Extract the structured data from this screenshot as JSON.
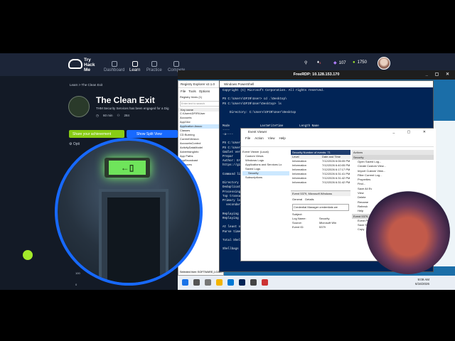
{
  "nav": {
    "logo_line1": "Try",
    "logo_line2": "Hack",
    "logo_line3": "Me",
    "items": [
      {
        "label": "Dashboard",
        "active": false
      },
      {
        "label": "Learn",
        "active": true
      },
      {
        "label": "Practice",
        "active": false
      },
      {
        "label": "Compete",
        "active": false
      }
    ],
    "points": "107",
    "streak": "1750",
    "notification_count": "3"
  },
  "room": {
    "breadcrumb": "Learn > The Clean Exit",
    "title": "The Clean Exit",
    "description": "THM Security Services has been engaged for a Dig",
    "duration": "60 min",
    "users": "284",
    "share_label": "Share your achievement",
    "split_label": "Show Split View",
    "options_label": "Opti"
  },
  "rdp": {
    "title": "FreeRDP: 10.128.153.170"
  },
  "regedit": {
    "title": "Registry Explorer v2.1.0",
    "menu": [
      "File",
      "Tools",
      "Options",
      "Bookm"
    ],
    "tab": "Registry hives (1)",
    "tab2": "Available bo",
    "search_placeholder": "Enter text to search",
    "col": "Key name",
    "tree": [
      "C:\\Users\\DFIR\\User",
      "Accounts",
      "AppXAe",
      "Application Assoc",
      "Classes",
      "CD Burning",
      "CurrentVersion",
      "AccountsControl",
      "ActivityDataModel",
      "AdvertisingInfo",
      "App Paths",
      "AppBroadcast",
      "Approves",
      "Applets"
    ],
    "status": "Selected hive: SOFTWARE_LOAD, Last write:",
    "status2": "Collapse all hives: SOFTWARE_ARC  Nodes"
  },
  "powershell": {
    "title": "Windows PowerShell",
    "lines": [
      "Copyright (C) Microsoft Corporation. All rights reserved.",
      "",
      "PS C:\\Users\\DFIR\\User> cd .\\Desktop\\",
      "PS C:\\Users\\DFIR\\User\\Desktop> ls",
      "",
      "    Directory: C:\\Users\\DFIR\\User\\Desktop",
      "",
      "",
      "Mode                 LastWriteTime         Length Name",
      "----                 -------------         ------ ----",
      "-a----    7/4/2024   9:44 AM         2810 ...",
      "",
      "PS C:\\Users\\",
      "PS C:\\Users\\",
      "Cmdlet ver",
      "Prepar",
      "Author: Eri",
      "https://git",
      "",
      "Command lin",
      "",
      "Directory (",
      "Deduplicati",
      "Processing",
      "Top transac",
      "Primary log",
      "  secondary",
      "",
      "Replaying L",
      "Replaying L",
      "",
      "At least on",
      "Parse time",
      "",
      "Total Shell",
      "",
      "Shellbags d"
    ]
  },
  "eventviewer": {
    "title": "Event Viewer",
    "menu": [
      "File",
      "Action",
      "View",
      "Help"
    ],
    "tree": [
      "Event Viewer (Local)",
      "Custom Views",
      "Windows Logs",
      "Applications and Services Lo",
      "Saved Logs",
      "Security",
      "Subscriptions"
    ],
    "list_header": "Security   Number of events: 71",
    "cols": [
      "Level",
      "Date and Time"
    ],
    "rows": [
      {
        "level": "Information",
        "date": "7/12/2026 6:06:05 PM"
      },
      {
        "level": "Information",
        "date": "7/12/2026 6:40:05 PM"
      },
      {
        "level": "Information",
        "date": "7/12/2026 6:17:17 PM"
      },
      {
        "level": "Information",
        "date": "7/12/2026 6:31:41 PM"
      },
      {
        "level": "Information",
        "date": "7/12/2026 6:31:42 PM"
      },
      {
        "level": "Information",
        "date": "7/12/2026 6:31:42 PM"
      }
    ],
    "detail_title": "Event 5379, Microsoft Windows",
    "detail_tabs": [
      "General",
      "Details"
    ],
    "detail_text": "Credential Manager credentials we",
    "subject": "Subject:",
    "fields": [
      {
        "k": "Log Name:",
        "v": "Security"
      },
      {
        "k": "Source:",
        "v": "Microsoft Win"
      },
      {
        "k": "Event ID:",
        "v": "5379"
      }
    ],
    "actions_header": "Actions",
    "actions_sub": "Security",
    "actions": [
      "Open Saved Log...",
      "Create Custom View...",
      "Import Custom View...",
      "Filter Current Log...",
      "Properties",
      "Find...",
      "Save All Ev",
      "View",
      "Delete",
      "Rename",
      "Refresh",
      "Help"
    ],
    "actions_sub2": "Event 5379, Microsoft Wi",
    "actions2": [
      "Event Properties",
      "Save Selected Events...",
      "Copy"
    ]
  },
  "taskbar": {
    "time": "9:09 AM",
    "date": "6/16/2026"
  },
  "chart_axis": {
    "top": "100",
    "bottom": "0"
  },
  "exit_sign_text": "←▯"
}
